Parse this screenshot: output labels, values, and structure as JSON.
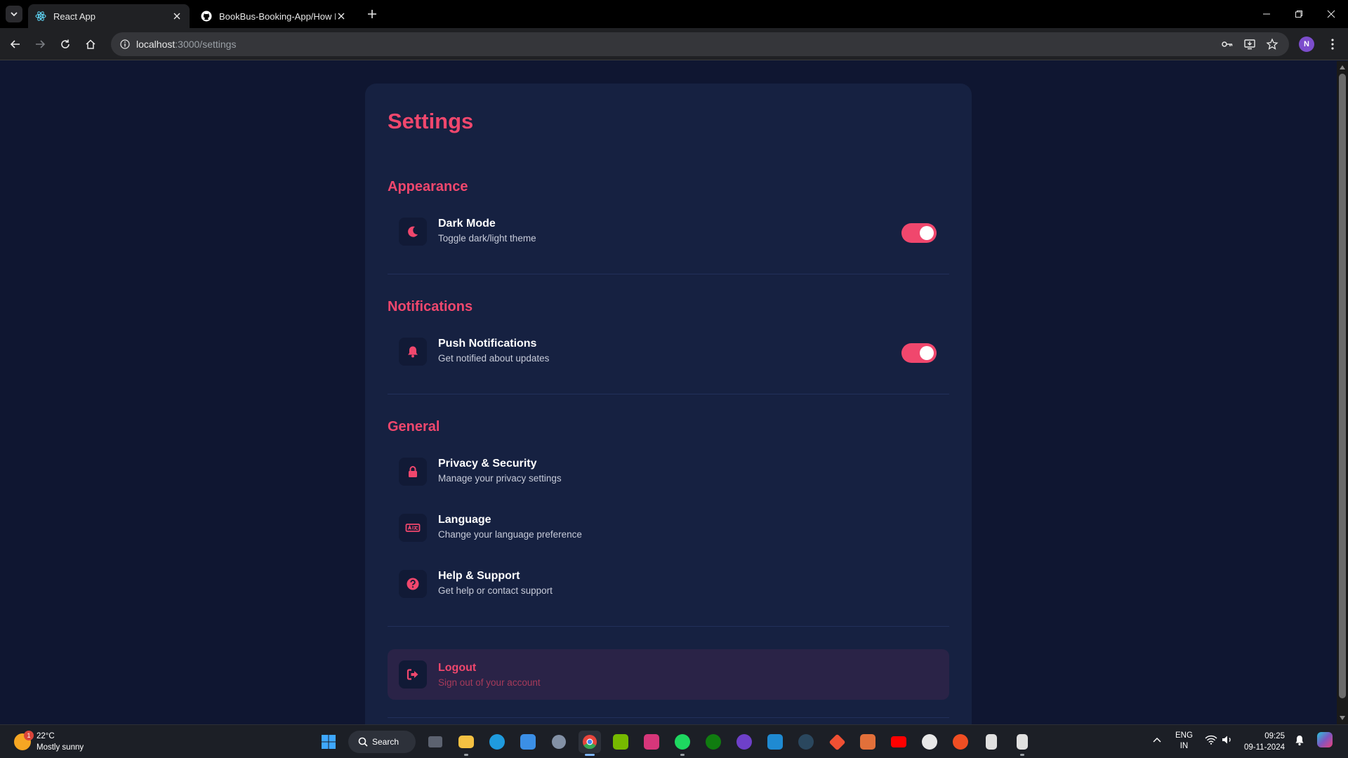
{
  "browser": {
    "tabs": [
      {
        "title": "React App",
        "active": true
      },
      {
        "title": "BookBus-Booking-App/How It W",
        "active": false
      }
    ],
    "url_host": "localhost",
    "url_path": ":3000/settings",
    "profile_initial": "N"
  },
  "settings": {
    "title": "Settings",
    "sections": {
      "appearance": {
        "title": "Appearance",
        "dark_mode": {
          "label": "Dark Mode",
          "description": "Toggle dark/light theme",
          "enabled": true
        }
      },
      "notifications": {
        "title": "Notifications",
        "push": {
          "label": "Push Notifications",
          "description": "Get notified about updates",
          "enabled": true
        }
      },
      "general": {
        "title": "General",
        "privacy": {
          "label": "Privacy & Security",
          "description": "Manage your privacy settings"
        },
        "language": {
          "label": "Language",
          "description": "Change your language preference"
        },
        "help": {
          "label": "Help & Support",
          "description": "Get help or contact support"
        }
      }
    },
    "logout": {
      "label": "Logout",
      "description": "Sign out of your account"
    }
  },
  "colors": {
    "accent": "#f0476d",
    "page_bg": "#0f1631",
    "card_bg": "#162141"
  },
  "taskbar": {
    "weather_temp": "22°C",
    "weather_desc": "Mostly sunny",
    "weather_badge": "1",
    "search_label": "Search",
    "lang_line1": "ENG",
    "lang_line2": "IN",
    "time": "09:25",
    "date": "09-11-2024"
  }
}
